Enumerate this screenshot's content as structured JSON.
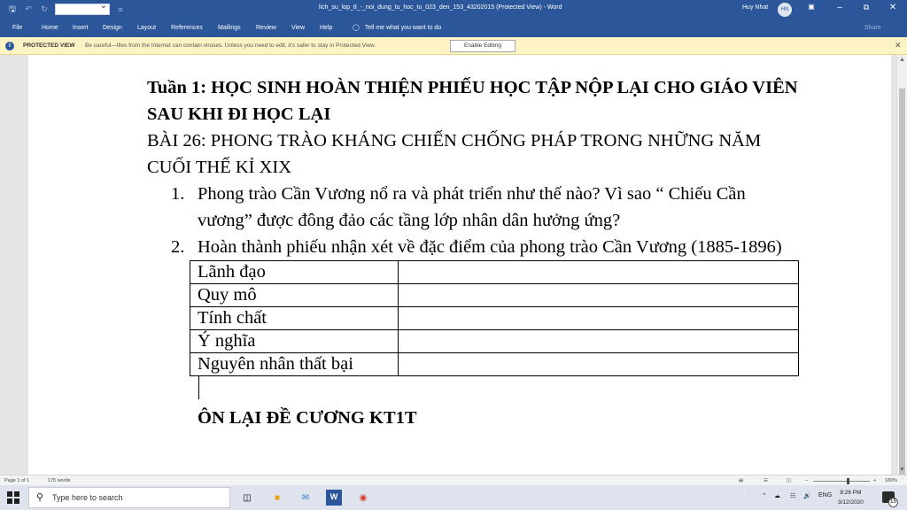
{
  "titlebar": {
    "doc_title": "lich_su_lop_8_-_noi_dung_tu_hoc_tu_023_den_153_43202015 (Protected View)  -  Word",
    "user_name": "Huy Nhat",
    "user_initials": "HN"
  },
  "menu": {
    "tabs": [
      "File",
      "Home",
      "Insert",
      "Design",
      "Layout",
      "References",
      "Mailings",
      "Review",
      "View",
      "Help"
    ],
    "tell_me": "Tell me what you want to do",
    "share": "Share"
  },
  "protected_view": {
    "label": "PROTECTED VIEW",
    "message": "Be careful—files from the Internet can contain viruses. Unless you need to edit, it's safer to stay in Protected View.",
    "enable_button": "Enable Editing"
  },
  "document": {
    "heading1": "Tuần 1: HỌC SINH HOÀN THIỆN PHIẾU HỌC TẬP NỘP LẠI CHO GIÁO VIÊN SAU KHI ĐI HỌC LẠI",
    "heading2": "BÀI 26: PHONG TRÀO KHÁNG CHIẾN CHỐNG PHÁP TRONG NHỮNG NĂM CUỐI THẾ KỈ XIX",
    "questions": [
      {
        "num": "1.",
        "text": "Phong trào Cần Vương nổ ra và phát triển như thế nào? Vì sao “ Chiếu Cần vương” được đông đảo các tầng lớp nhân dân hưởng ứng?"
      },
      {
        "num": "2.",
        "text": "Hoàn thành phiếu nhận xét về đặc điểm của phong trào Cần Vương (1885-1896)"
      }
    ],
    "table_rows": [
      "Lãnh đạo",
      "Quy mô",
      "Tính chất",
      "Ý nghĩa",
      "Nguyên nhân thất bại"
    ],
    "section_heading": "ÔN LẠI ĐỀ CƯƠNG KT1T"
  },
  "status": {
    "page": "Page 1 of 1",
    "words": "175 words",
    "zoom": "180%"
  },
  "taskbar": {
    "search_placeholder": "Type here to search",
    "language": "ENG",
    "time": "8:26 PM",
    "date": "3/12/2020",
    "notifications": "15"
  }
}
